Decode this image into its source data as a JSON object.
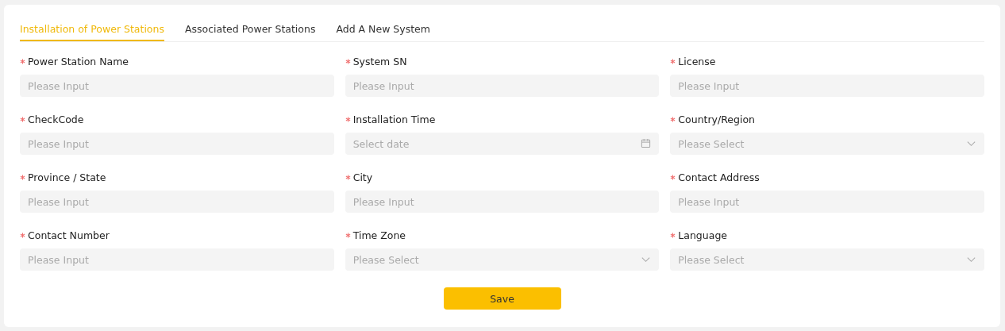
{
  "tabs": [
    {
      "label": "Installation of Power Stations",
      "selected": true
    },
    {
      "label": "Associated Power Stations",
      "selected": false
    },
    {
      "label": "Add A New System",
      "selected": false
    }
  ],
  "fields": [
    {
      "label": "Power Station Name",
      "required": true,
      "kind": "input",
      "placeholder": "Please Input"
    },
    {
      "label": "System SN",
      "required": true,
      "kind": "input",
      "placeholder": "Please Input"
    },
    {
      "label": "License",
      "required": true,
      "kind": "input",
      "placeholder": "Please Input"
    },
    {
      "label": "CheckCode",
      "required": true,
      "kind": "input",
      "placeholder": "Please Input"
    },
    {
      "label": "Installation Time",
      "required": true,
      "kind": "date",
      "placeholder": "Select date"
    },
    {
      "label": "Country/Region",
      "required": true,
      "kind": "select",
      "placeholder": "Please Select"
    },
    {
      "label": "Province / State",
      "required": true,
      "kind": "input",
      "placeholder": "Please Input"
    },
    {
      "label": "City",
      "required": true,
      "kind": "input",
      "placeholder": "Please Input"
    },
    {
      "label": "Contact Address",
      "required": true,
      "kind": "input",
      "placeholder": "Please Input"
    },
    {
      "label": "Contact Number",
      "required": true,
      "kind": "input",
      "placeholder": "Please Input"
    },
    {
      "label": "Time Zone",
      "required": true,
      "kind": "select",
      "placeholder": "Please Select"
    },
    {
      "label": "Language",
      "required": true,
      "kind": "select",
      "placeholder": "Please Select"
    }
  ],
  "save_button": "Save"
}
